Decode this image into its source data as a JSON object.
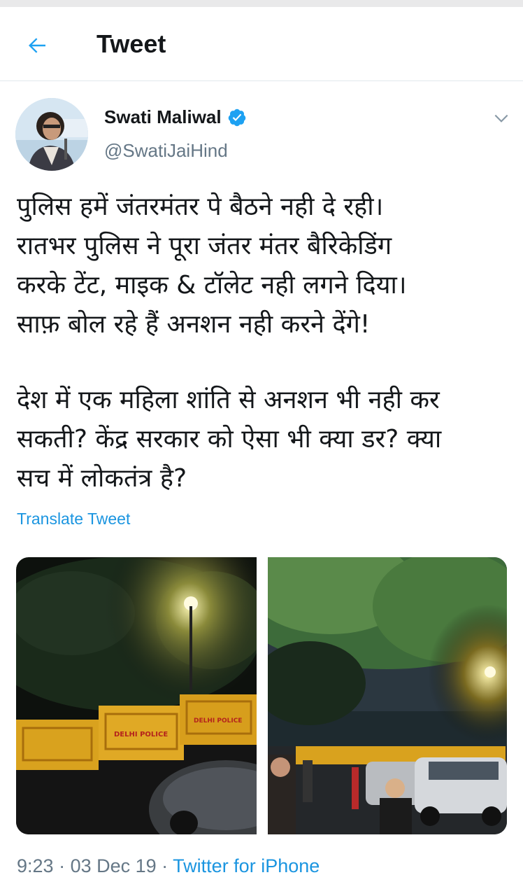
{
  "header": {
    "title": "Tweet",
    "back_icon": "arrow-left-icon",
    "accent_color": "#1DA1F2"
  },
  "tweet": {
    "author": {
      "name": "Swati Maliwal",
      "handle": "@SwatiJaiHind",
      "verified": true,
      "verified_icon": "verified-badge-icon"
    },
    "options_icon": "chevron-down-icon",
    "paragraphs": [
      [
        "पुलिस हमें जंतरमंतर पे बैठने नही दे रही।",
        "रातभर पुलिस ने पूरा जंतर मंतर बैरिकेडिंग",
        "करके टेंट, माइक & टॉलेट नही लगने दिया।",
        "साफ़ बोल रहे हैं अनशन नही करने देंगे!"
      ],
      [
        "देश में एक महिला शांति से अनशन भी नही कर",
        "सकती? केंद्र सरकार को ऐसा भी क्या डर? क्या",
        "सच में लोकतंत्र है?"
      ]
    ],
    "translate_label": "Translate Tweet",
    "media": [
      {
        "description_name": "photo-barricades-night",
        "text": "DELHI POLICE"
      },
      {
        "description_name": "photo-street-night"
      }
    ],
    "meta": {
      "time": "9:23",
      "separator": " · ",
      "date": "03 Dec 19",
      "source": "Twitter for iPhone"
    }
  },
  "colors": {
    "link": "#1B95E0",
    "secondary_text": "#657786",
    "primary_text": "#14171A",
    "divider": "#E1E8ED"
  }
}
